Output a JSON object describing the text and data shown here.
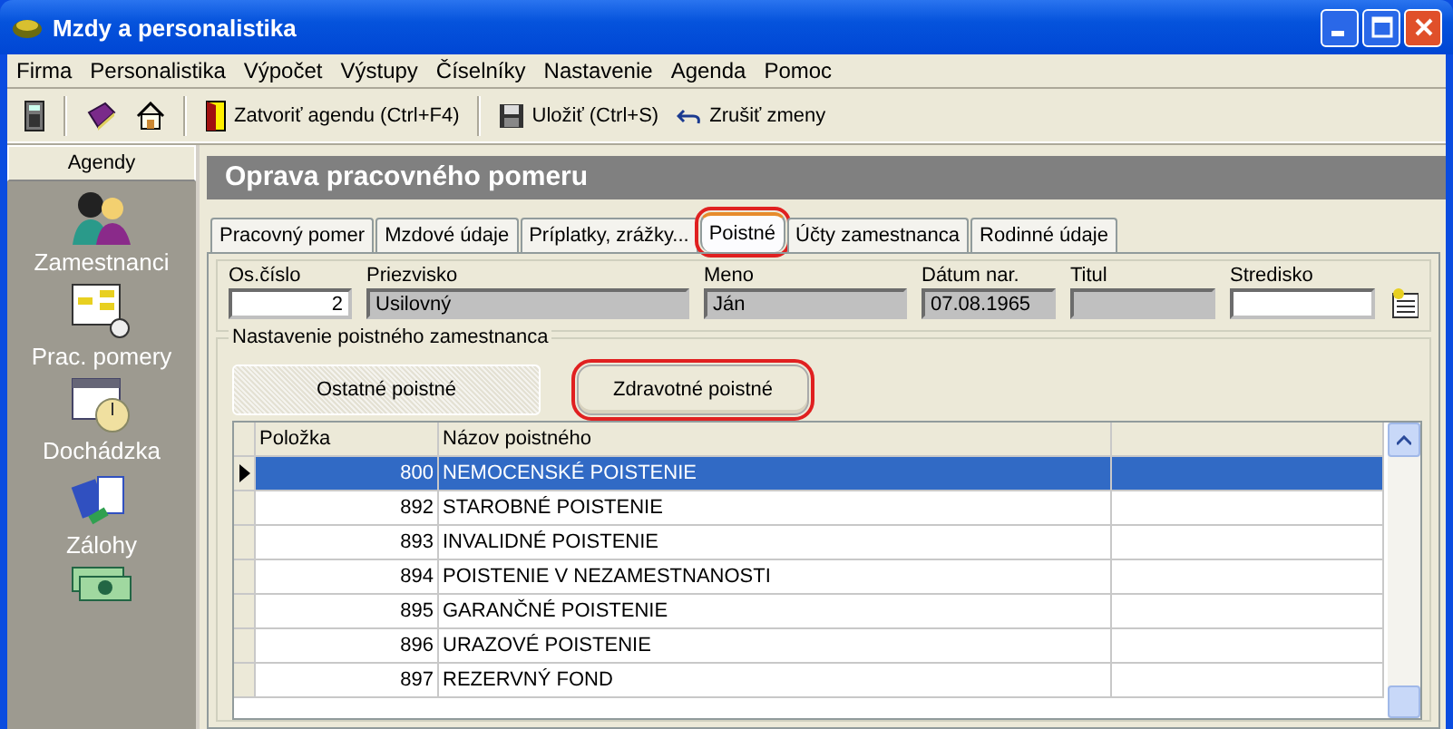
{
  "window": {
    "title": "Mzdy a personalistika"
  },
  "menu": [
    "Firma",
    "Personalistika",
    "Výpočet",
    "Výstupy",
    "Číselníky",
    "Nastavenie",
    "Agenda",
    "Pomoc"
  ],
  "toolbar": [
    {
      "kind": "calculator"
    },
    {
      "kind": "separator"
    },
    {
      "kind": "book"
    },
    {
      "kind": "home"
    },
    {
      "kind": "separator"
    },
    {
      "kind": "door",
      "label": "Zatvoriť agendu (Ctrl+F4)"
    },
    {
      "kind": "separator"
    },
    {
      "kind": "disk",
      "label": "Uložiť (Ctrl+S)"
    },
    {
      "kind": "undo",
      "label": "Zrušiť zmeny"
    }
  ],
  "sidebar": {
    "title": "Agendy",
    "items": [
      {
        "kind": "people",
        "label": "Zamestnanci"
      },
      {
        "kind": "chart",
        "label": "Prac. pomery"
      },
      {
        "kind": "calendar",
        "label": "Dochádzka"
      },
      {
        "kind": "cards",
        "label": "Zálohy"
      },
      {
        "kind": "money"
      }
    ]
  },
  "panel": {
    "title": "Oprava pracovného pomeru"
  },
  "tabs": [
    {
      "label": "Pracovný pomer",
      "selected": false,
      "highlighted": false
    },
    {
      "label": "Mzdové údaje",
      "selected": false,
      "highlighted": false
    },
    {
      "label": "Príplatky, zrážky...",
      "selected": false,
      "highlighted": false
    },
    {
      "label": "Poistné",
      "selected": true,
      "highlighted": true
    },
    {
      "label": "Účty zamestnanca",
      "selected": false,
      "highlighted": false
    },
    {
      "label": "Rodinné údaje",
      "selected": false,
      "highlighted": false
    }
  ],
  "fields": [
    {
      "label": "Os.číslo",
      "value": "2",
      "readonly": false,
      "kind": "number"
    },
    {
      "label": "Priezvisko",
      "value": "Usilovný",
      "readonly": true,
      "kind": "text"
    },
    {
      "label": "Meno",
      "value": "Ján",
      "readonly": true,
      "kind": "text"
    },
    {
      "label": "Dátum nar.",
      "value": "07.08.1965",
      "readonly": true,
      "kind": "text"
    },
    {
      "label": "Titul",
      "readonly": true,
      "kind": "text"
    },
    {
      "label": "Stredisko",
      "readonly": false,
      "kind": "text"
    }
  ],
  "group": {
    "title": "Nastavenie poistného zamestnanca",
    "buttons": [
      {
        "label": "Ostatné poistné",
        "selected": true,
        "highlighted": false
      },
      {
        "label": "Zdravotné poistné",
        "selected": false,
        "highlighted": true
      }
    ]
  },
  "table": {
    "columns": [
      "Položka",
      "Názov poistného"
    ],
    "rows": [
      {
        "code": "800",
        "name": "NEMOCENSKÉ POISTENIE",
        "selected": true
      },
      {
        "code": "892",
        "name": "STAROBNÉ POISTENIE",
        "selected": false
      },
      {
        "code": "893",
        "name": "INVALIDNÉ POISTENIE",
        "selected": false
      },
      {
        "code": "894",
        "name": "POISTENIE V NEZAMESTNANOSTI",
        "selected": false
      },
      {
        "code": "895",
        "name": "GARANČNÉ POISTENIE",
        "selected": false
      },
      {
        "code": "896",
        "name": "URAZOVÉ POISTENIE",
        "selected": false
      },
      {
        "code": "897",
        "name": "REZERVNÝ FOND",
        "selected": false
      }
    ]
  }
}
